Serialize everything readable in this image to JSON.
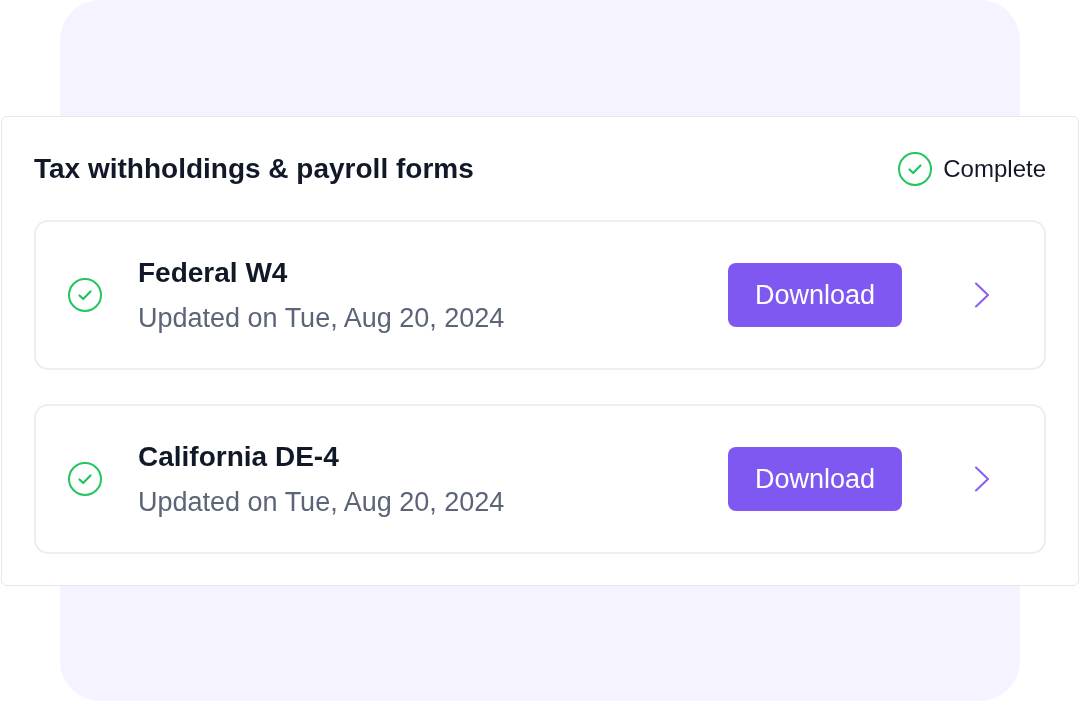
{
  "card": {
    "title": "Tax withholdings & payroll forms",
    "status": {
      "label": "Complete",
      "complete": true
    }
  },
  "forms": [
    {
      "name": "Federal W4",
      "updated": "Updated on Tue, Aug 20, 2024",
      "complete": true,
      "action": "Download"
    },
    {
      "name": "California DE-4",
      "updated": "Updated on Tue, Aug 20, 2024",
      "complete": true,
      "action": "Download"
    }
  ]
}
